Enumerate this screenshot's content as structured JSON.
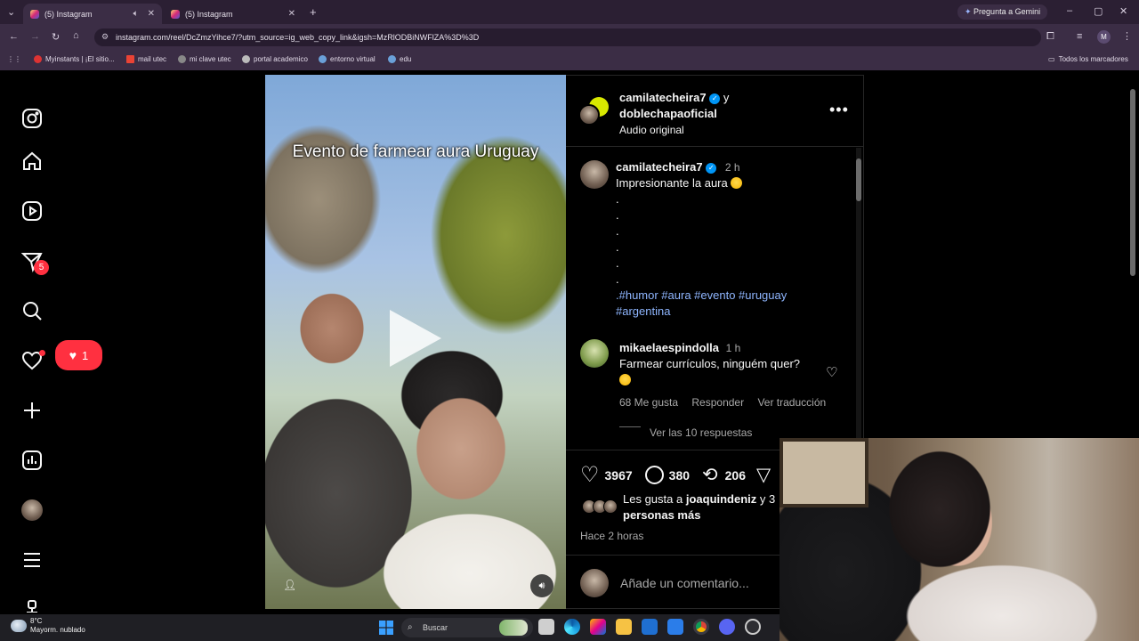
{
  "browser": {
    "tabs": [
      {
        "label": "(5) Instagram"
      },
      {
        "label": "(5) Instagram"
      }
    ],
    "gemini_button": "Pregunta a Gemini",
    "url": "instagram.com/reel/DcZmzYihce7/?utm_source=ig_web_copy_link&igsh=MzRlODBiNWFlZA%3D%3D",
    "bookmarks": [
      {
        "label": "Myinstants | ¡El sitio..."
      },
      {
        "label": "mail utec"
      },
      {
        "label": "mi clave utec"
      },
      {
        "label": "portal academico"
      },
      {
        "label": "entorno virtual"
      },
      {
        "label": "edu"
      }
    ],
    "all_bookmarks": "Todos los marcadores",
    "profile_initial": "M"
  },
  "sidebar": {
    "messages_badge": "5",
    "notification_count": "1"
  },
  "reel": {
    "overlay_title": "Evento de farmear aura Uruguay"
  },
  "post": {
    "header_user1": "camilatecheira7",
    "header_joiner": "y",
    "header_user2": "doblechapaoficial",
    "audio": "Audio original",
    "caption_user": "camilatecheira7",
    "caption_time": "2 h",
    "caption_text": "Impresionante la aura",
    "caption_hashtags": ".#humor #aura #evento #uruguay",
    "caption_hashtags2": "#argentina",
    "comment": {
      "user": "mikaelaespindolla",
      "time": "1 h",
      "text": "Farmear currículos, ninguém quer?",
      "likes": "68 Me gusta",
      "reply": "Responder",
      "translate": "Ver traducción",
      "view_replies": "Ver las 10 respuestas"
    },
    "stats": {
      "likes": "3967",
      "comments": "380",
      "reposts": "206"
    },
    "liked_by_prefix": "Les gusta a",
    "liked_by_user": "joaquindeniz",
    "liked_by_suffix": "y 3",
    "liked_by_line2": "personas más",
    "posted_ago": "Hace 2 horas",
    "comment_placeholder": "Añade un comentario..."
  },
  "taskbar": {
    "weather_temp": "8°C",
    "weather_desc": "Mayorm. nublado",
    "search": "Buscar"
  }
}
